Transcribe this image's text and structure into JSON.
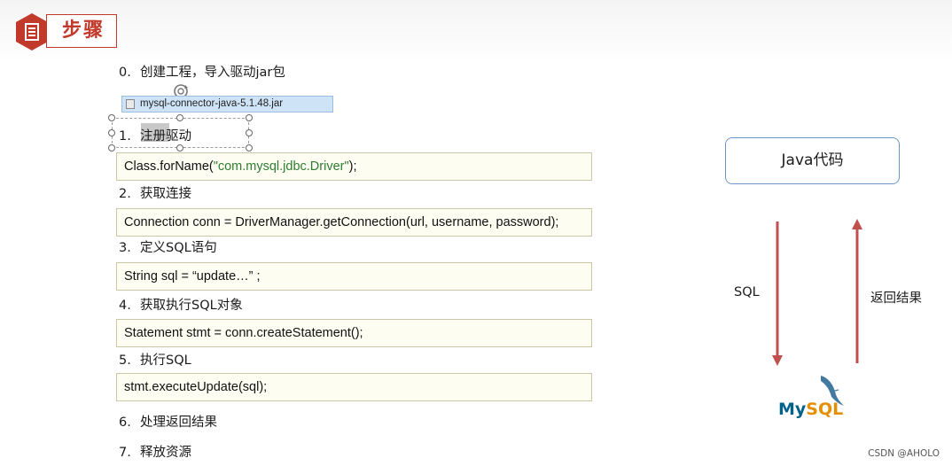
{
  "header": {
    "title": "步骤",
    "logo_icon": "document-icon"
  },
  "steps": [
    {
      "num": "0.",
      "text": "创建工程，导入驱动jar包"
    },
    {
      "num": "1.",
      "text_highlight": "注册",
      "text_rest": "驱动"
    },
    {
      "num": "2.",
      "text": "获取连接"
    },
    {
      "num": "3.",
      "text": "定义SQL语句"
    },
    {
      "num": "4.",
      "text": "获取执行SQL对象"
    },
    {
      "num": "5.",
      "text": "执行SQL"
    },
    {
      "num": "6.",
      "text": "处理返回结果"
    },
    {
      "num": "7.",
      "text": "释放资源"
    }
  ],
  "jar_file": {
    "name": "mysql-connector-java-5.1.48.jar",
    "icon": "jar-file-icon"
  },
  "code": {
    "register_prefix": "Class.forName(",
    "register_string": "\"com.mysql.jdbc.Driver\"",
    "register_suffix": ");",
    "connection": "Connection conn = DriverManager.getConnection(url, username, password);",
    "sql": "String sql =  “update…” ;",
    "statement": "Statement stmt = conn.createStatement();",
    "execute": "stmt.executeUpdate(sql);"
  },
  "diagram": {
    "java_box": "Java代码",
    "down_label": "SQL",
    "up_label": "返回结果",
    "db_logo": "MySQL",
    "arrow_color": "#c0504d"
  },
  "watermark": "CSDN @AHOLO",
  "colors": {
    "accent": "#c0392b",
    "code_string": "#2e7d32"
  }
}
